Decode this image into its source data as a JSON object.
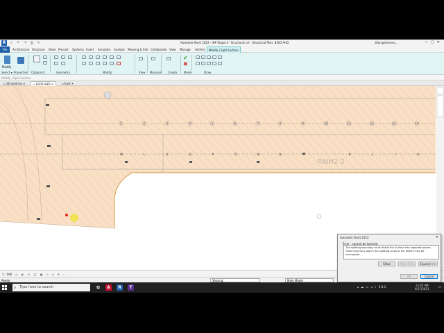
{
  "window": {
    "title": "Autodesk Revit 2022 - IHP Stage 4 - Structural.rvt - Structural Plan: B200 AHD",
    "user": "dilan@intersec...",
    "controls": [
      "—",
      "▢",
      "✕"
    ]
  },
  "ribbon": {
    "file_tab": "File",
    "tabs": [
      "Architecture",
      "Structure",
      "Steel",
      "Precast",
      "Systems",
      "Insert",
      "Annotate",
      "Analyze",
      "Massing & Site",
      "Collaborate",
      "View",
      "Manage",
      "Add-Ins",
      "Modify | Split Surface"
    ],
    "active_tab": "Modify | Split Surface",
    "panels": [
      "Select ▾",
      "Properties",
      "Clipboard",
      "Geometry",
      "Modify",
      "View",
      "Measure",
      "Create",
      "Mode",
      "Draw"
    ],
    "modify_label": "Modify"
  },
  "options_bar": {
    "text": "Modify | Split Surface"
  },
  "view_tabs": [
    {
      "label": "3D working",
      "active": false
    },
    {
      "label": "B200 AHD",
      "active": true
    },
    {
      "label": "East",
      "active": false
    }
  ],
  "canvas": {
    "grid_labels": [
      "M",
      "L",
      "K",
      "Q",
      "P",
      "O",
      "N",
      "N",
      "K",
      "J",
      "I",
      "H"
    ],
    "column_markers": [
      "1",
      "2",
      "3",
      "4",
      "5",
      "6",
      "7",
      "8",
      "9",
      "10",
      "11",
      "12",
      "13",
      "14",
      "15"
    ],
    "watermark": "RWH2-2",
    "colors": {
      "surface": "#f9dfc4",
      "linework": "#c9a98a",
      "grid": "#8c8c8c",
      "cursor": "#f0e33a",
      "point": "#e0201e"
    }
  },
  "view_control": {
    "scale": "1 : 100"
  },
  "status": {
    "ready": "Ready",
    "workset": "Sharing",
    "model": "Main Model"
  },
  "dialog": {
    "title": "Autodesk Revit 2022",
    "close": "✕",
    "error_header": "Error - cannot be ignored",
    "message": "The splitting boundary must divide the Surface into separate pieces. There may be a gap in the splitting Lines or the Sketch may be incomplete.",
    "buttons": {
      "show": "Show",
      "more_info": "More Info",
      "expand": "Expand >>",
      "ok": "OK",
      "cancel": "Cancel"
    }
  },
  "taskbar": {
    "search_placeholder": "Type here to search",
    "tray_lang": "ENG",
    "time": "12:05 PM",
    "date": "9/17/2021"
  }
}
